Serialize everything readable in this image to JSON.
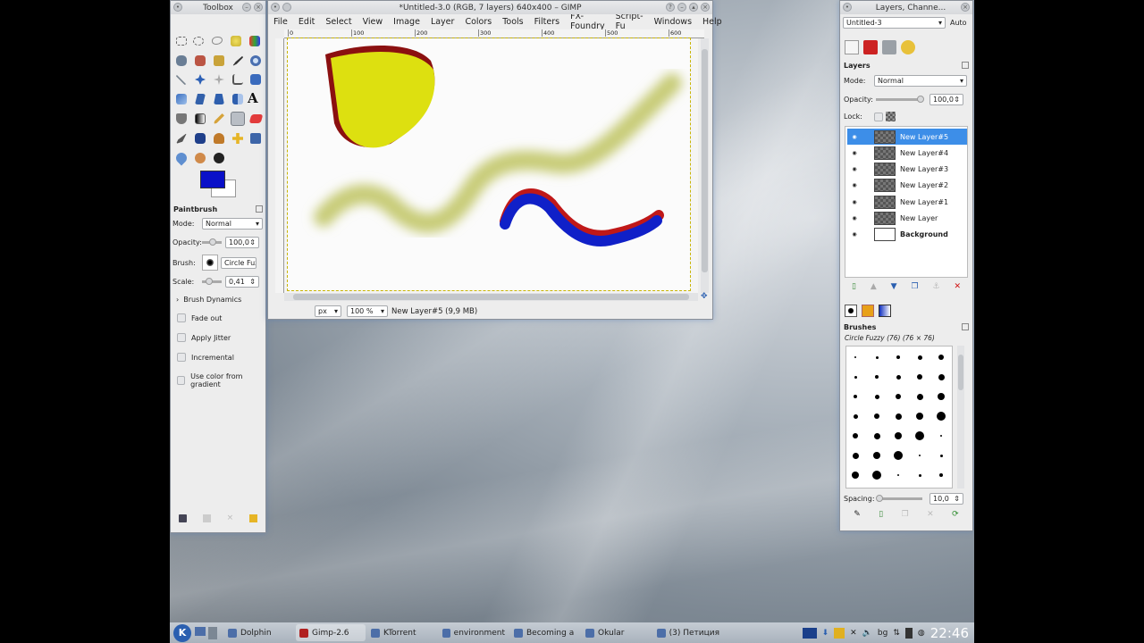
{
  "toolbox": {
    "title": "Toolbox",
    "options_title": "Paintbrush",
    "mode_label": "Mode:",
    "mode_value": "Normal",
    "opacity_label": "Opacity:",
    "opacity_value": "100,0",
    "brush_label": "Brush:",
    "brush_value": "Circle Fuzz",
    "scale_label": "Scale:",
    "scale_value": "0,41",
    "brush_dynamics": "Brush Dynamics",
    "fade_out": "Fade out",
    "apply_jitter": "Apply Jitter",
    "incremental": "Incremental",
    "use_color_gradient": "Use color from gradient",
    "fg_color": "#0a10c8",
    "bg_color": "#ffffff"
  },
  "image_window": {
    "title": "*Untitled-3.0 (RGB, 7 layers) 640x400 – GIMP",
    "menu": [
      "File",
      "Edit",
      "Select",
      "View",
      "Image",
      "Layer",
      "Colors",
      "Tools",
      "Filters",
      "FX-Foundry",
      "Script-Fu",
      "Windows",
      "Help"
    ],
    "ruler_marks": [
      "0",
      "100",
      "200",
      "300",
      "400",
      "500",
      "600"
    ],
    "unit": "px",
    "zoom": "100 %",
    "status": "New Layer#5 (9,9 MB)"
  },
  "layers_window": {
    "title": "Layers, Channe...",
    "image_select": "Untitled-3",
    "auto_label": "Auto",
    "layers_title": "Layers",
    "mode_label": "Mode:",
    "mode_value": "Normal",
    "opacity_label": "Opacity:",
    "opacity_value": "100,0",
    "lock_label": "Lock:",
    "layers": [
      {
        "name": "New Layer#5",
        "selected": true
      },
      {
        "name": "New Layer#4",
        "selected": false
      },
      {
        "name": "New Layer#3",
        "selected": false
      },
      {
        "name": "New Layer#2",
        "selected": false
      },
      {
        "name": "New Layer#1",
        "selected": false
      },
      {
        "name": "New Layer",
        "selected": false
      },
      {
        "name": "Background",
        "selected": false
      }
    ],
    "brushes_title": "Brushes",
    "brush_name": "Circle Fuzzy (76) (76 × 76)",
    "spacing_label": "Spacing:",
    "spacing_value": "10,0"
  },
  "taskbar": {
    "tasks": [
      "Dolphin",
      "Gimp-2.6",
      "KTorrent",
      "environment",
      "Becoming a",
      "Okular",
      "(3) Петиция"
    ],
    "lang": "bg",
    "clock": "22:46"
  }
}
